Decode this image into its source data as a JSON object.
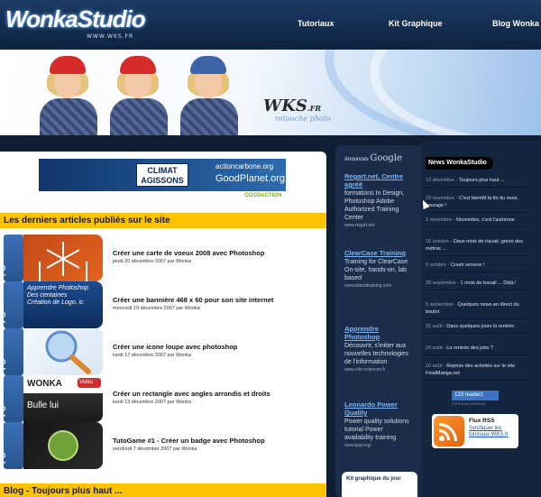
{
  "header": {
    "logo_text": "WonkaStudio",
    "logo_sub": "WWW.WKS.FR",
    "nav": [
      "Tutoriaux",
      "Kit Graphique",
      "Blog Wonka"
    ]
  },
  "banner": {
    "wks_logo": "WKS",
    "wks_suffix": ".FR",
    "wks_tag": "retouche photo"
  },
  "ad_banner": {
    "box_line1": "CLIMAT",
    "box_line2": "AGISSONS",
    "brand1": "actioncarbone.org",
    "brand2": "GoodPlanet.org",
    "small": "GOODACTION"
  },
  "articles_section": {
    "title": "Les derniers articles publiés sur le site",
    "items": [
      {
        "badge": "PS",
        "title": "Créer une carte de voeux 2008 avec Photoshop",
        "date": "jeudi 20 décembre 2007 par Wonka",
        "thumb_caption": ""
      },
      {
        "badge": "PS",
        "title": "Créer une bannière 468 x 60 pour son site internet",
        "date": "mercredi 19 décembre 2007 par Wonka",
        "thumb_caption": "Apprendre Photoshop\nDes centaines\nCréation de Logo, ic"
      },
      {
        "badge": "PS",
        "title": "Créer une icone loupe avec photoshop",
        "date": "lundi 17 décembre 2007 par Wonka",
        "thumb_caption": ""
      },
      {
        "badge": "PS",
        "title": "Créer un rectangle avec angles arrondis et droits",
        "date": "lundi 13 décembre 2007 par Wonka",
        "thumb_caption": "Bulle lui"
      },
      {
        "badge": "PS",
        "title": "TutoGame #1 - Créer un badge avec Photoshop",
        "date": "vendredi 7 décembre 2007 par Wonka",
        "thumb_caption": ""
      }
    ]
  },
  "blog_section": {
    "title": "Blog - Toujours plus haut ..."
  },
  "google_ads": {
    "label": "Annonces",
    "brand": "Google",
    "ads": [
      {
        "title": "Regart.net, Centre agréé",
        "text": "formations In Design, Photoshop Adobe Authorized Training Center",
        "url": "www.regart.net"
      },
      {
        "title": "ClearCase Training",
        "text": "Training for ClearCase On-site, hands-on, lab based",
        "url": "www.islandtraining.com"
      },
      {
        "title": "Apprendre Photoshop",
        "text": "Découvrir, s'initier aux nouvelles technologies de l'information",
        "url": "www.cite-sciences.fr"
      },
      {
        "title": "Leonardo Power Quality",
        "text": "Power quality solutions tutorial Power availability training",
        "url": "www.lpqi.org/"
      }
    ]
  },
  "kit_box": {
    "label": "Kit graphique du jour"
  },
  "news": {
    "label": "News WonkaStudio",
    "items": [
      {
        "date": "13 décembre",
        "text": "Toujours plus haut ..."
      },
      {
        "date": "23 novembre",
        "text": "C'est bientôt la fin du mois, courage !"
      },
      {
        "date": "2 novembre",
        "text": "Novembre, c'est l'automne"
      },
      {
        "date": "18 octobre",
        "text": "Deux mois de travail, grève des métros ..."
      },
      {
        "date": "5 octobre",
        "text": "Crash serveur !"
      },
      {
        "date": "28 septembre",
        "text": "1 mois de travail ... Déjà !"
      },
      {
        "date": "5 septembre",
        "text": "Quelques news en direct du boulot"
      },
      {
        "date": "31 août",
        "text": "Dans quelques jours la rentrée"
      },
      {
        "date": "24 août",
        "text": "La rentrée des jobs ?"
      },
      {
        "date": "16 août",
        "text": "Reprise des activités sur le site FinalManga.net"
      }
    ]
  },
  "readerz": {
    "text": "123 readerz",
    "sub": "FEEDBURNER"
  },
  "rss": {
    "title": "Flux RSS",
    "text": "Syndiquer les tutoriaux WKS.fr"
  },
  "colors": {
    "accent": "#fdc300",
    "header": "#1b3a63",
    "link": "#7fb4f0"
  }
}
